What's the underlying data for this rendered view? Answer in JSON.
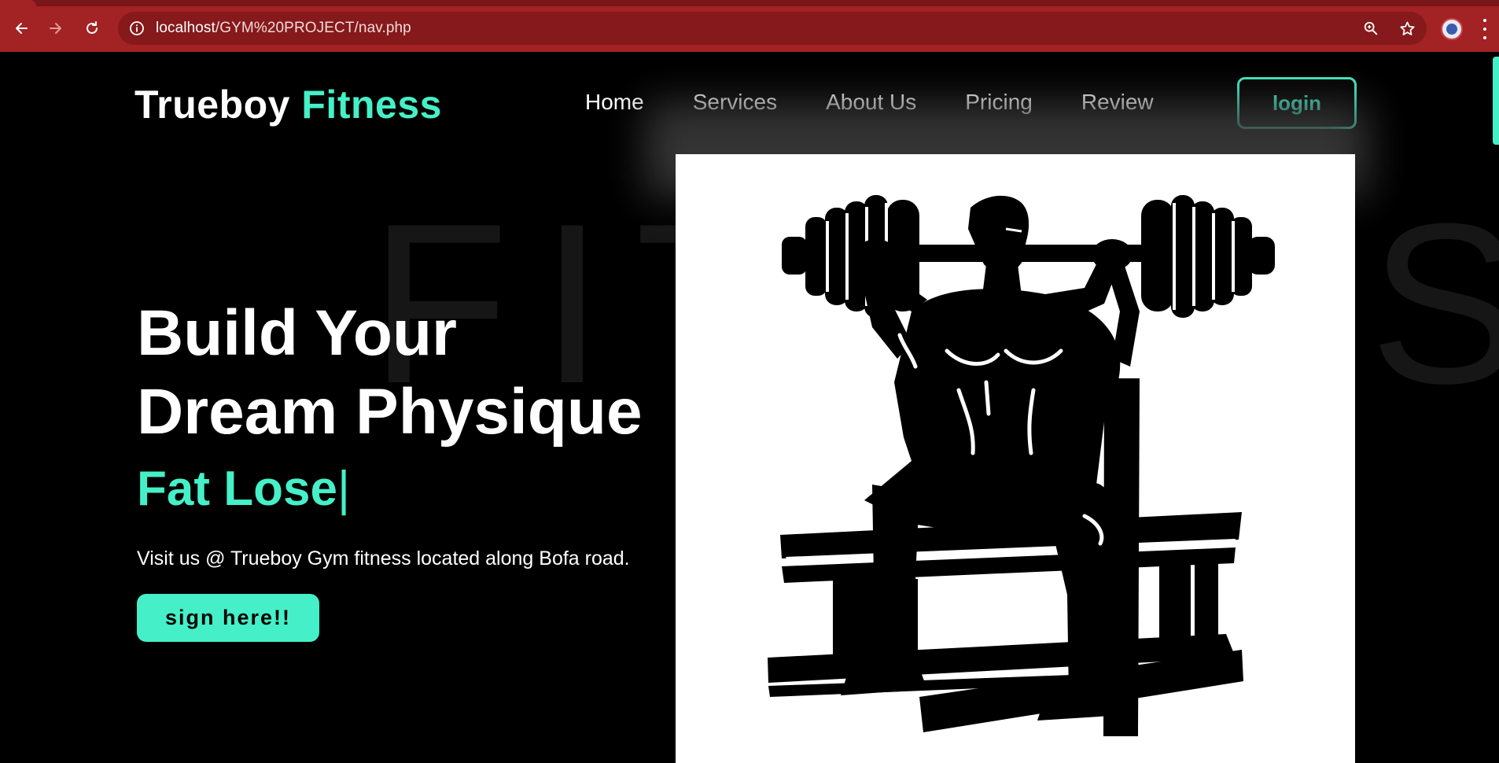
{
  "browser": {
    "url_host": "localhost",
    "url_path": "/GYM%20PROJECT/nav.php",
    "icons": {
      "back": "back-arrow-icon",
      "forward": "forward-arrow-icon",
      "reload": "reload-icon",
      "site_info": "info-icon",
      "zoom": "zoom-icon",
      "bookmark": "star-icon",
      "profile": "profile-avatar",
      "menu": "kebab-menu-icon"
    },
    "chrome_color": "#a32224"
  },
  "nav": {
    "logo_main": "Trueboy",
    "logo_accent": "Fitness",
    "items": [
      {
        "label": "Home"
      },
      {
        "label": "Services"
      },
      {
        "label": "About Us"
      },
      {
        "label": "Pricing"
      },
      {
        "label": "Review"
      }
    ],
    "login_label": "login"
  },
  "hero": {
    "background_word": "FITNESS",
    "title_line1": "Build Your",
    "title_line2": "Dream Physique",
    "typed_text": "Fat Lose",
    "caret": "|",
    "description": "Visit us @ Trueboy Gym fitness located along Bofa road.",
    "cta_label": "sign here!!"
  },
  "theme": {
    "accent": "#45f0c8",
    "background": "#000000",
    "text": "#ffffff"
  }
}
